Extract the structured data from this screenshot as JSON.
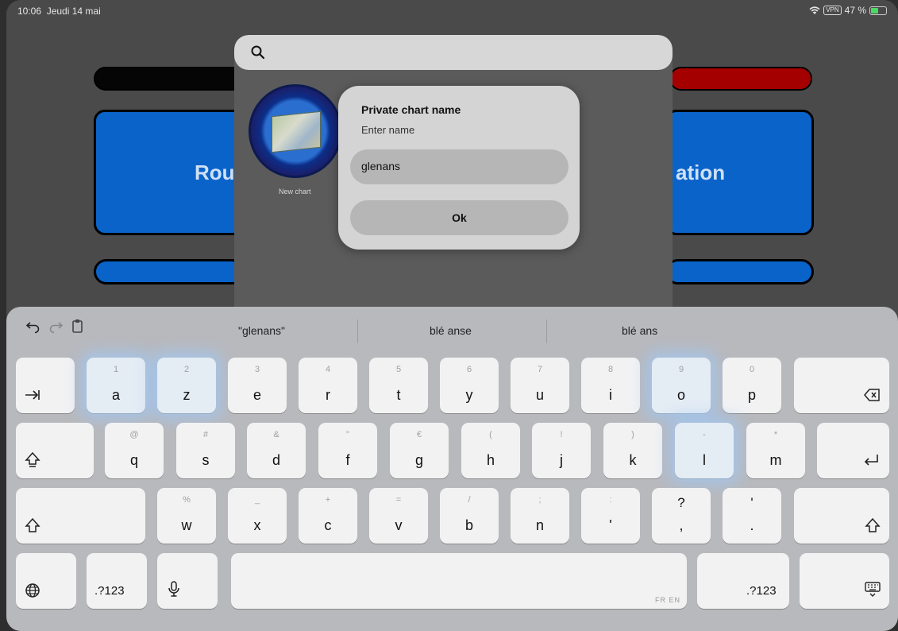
{
  "status_bar": {
    "time": "10:06",
    "date": "Jeudi 14 mai",
    "vpn": "VPN",
    "battery": "47 %"
  },
  "background_app": {
    "left_button_label": "Rou",
    "right_button_label": "ation"
  },
  "chart_picker": {
    "search_placeholder": "",
    "new_chart_label": "New chart"
  },
  "dialog": {
    "title": "Private chart name",
    "subtitle": "Enter name",
    "input_value": "glenans",
    "ok_label": "Ok"
  },
  "keyboard": {
    "suggestions": [
      "\"glenans\"",
      "blé anse",
      "blé ans"
    ],
    "row1": [
      {
        "main": "a",
        "alt": "1"
      },
      {
        "main": "z",
        "alt": "2"
      },
      {
        "main": "e",
        "alt": "3"
      },
      {
        "main": "r",
        "alt": "4"
      },
      {
        "main": "t",
        "alt": "5"
      },
      {
        "main": "y",
        "alt": "6"
      },
      {
        "main": "u",
        "alt": "7"
      },
      {
        "main": "i",
        "alt": "8"
      },
      {
        "main": "o",
        "alt": "9"
      },
      {
        "main": "p",
        "alt": "0"
      }
    ],
    "row2": [
      {
        "main": "q",
        "alt": "@"
      },
      {
        "main": "s",
        "alt": "#"
      },
      {
        "main": "d",
        "alt": "&"
      },
      {
        "main": "f",
        "alt": "\""
      },
      {
        "main": "g",
        "alt": "€"
      },
      {
        "main": "h",
        "alt": "("
      },
      {
        "main": "j",
        "alt": "!"
      },
      {
        "main": "k",
        "alt": ")"
      },
      {
        "main": "l",
        "alt": "-"
      },
      {
        "main": "m",
        "alt": "*"
      }
    ],
    "row3": [
      {
        "main": "w",
        "alt": "%"
      },
      {
        "main": "x",
        "alt": "_"
      },
      {
        "main": "c",
        "alt": "+"
      },
      {
        "main": "v",
        "alt": "="
      },
      {
        "main": "b",
        "alt": "/"
      },
      {
        "main": "n",
        "alt": ";"
      },
      {
        "main": "'",
        "alt": ":"
      },
      {
        "main": ",",
        "alt": "?"
      },
      {
        "main": ".",
        "alt": "'"
      }
    ],
    "numbers_label": ".?123",
    "language_tag": "FR EN",
    "icons": {
      "undo": "undo-icon",
      "redo": "redo-icon",
      "paste": "paste-icon",
      "tab": "tab-icon",
      "delete": "delete-icon",
      "caps": "caps-lock-icon",
      "return": "return-icon",
      "shift": "shift-icon",
      "globe": "globe-icon",
      "mic": "microphone-icon",
      "dismiss": "keyboard-dismiss-icon"
    }
  },
  "colors": {
    "accent_blue": "#0a63c9",
    "accent_red": "#a50000",
    "battery_green": "#4cd964"
  }
}
